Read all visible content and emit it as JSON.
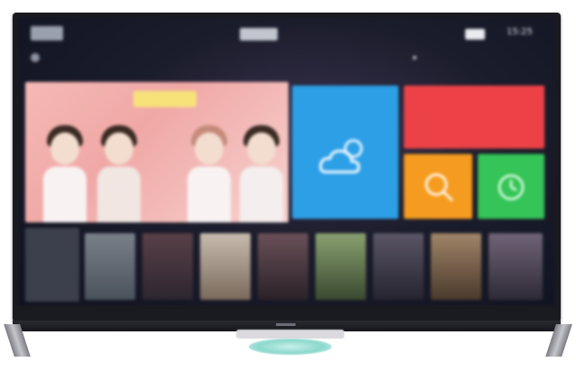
{
  "topbar": {
    "tabs": [
      {
        "label": "",
        "active": true
      },
      {
        "label": "",
        "active": false
      },
      {
        "label": "",
        "active": false
      },
      {
        "label": "",
        "active": false
      },
      {
        "label": "",
        "active": true
      },
      {
        "label": "",
        "active": false
      }
    ],
    "status_badge": "",
    "clock": "15:25"
  },
  "ticker": {
    "text": ""
  },
  "hero": {
    "banner": ""
  },
  "weather_tile": {
    "title": "",
    "subtitle": "",
    "detail": "",
    "icon": "cloud-sun-icon",
    "color": "#2d9fe6"
  },
  "red_tile": {
    "lines": [
      "",
      "",
      "",
      ""
    ],
    "color": "#ec4247"
  },
  "orange_tile": {
    "icon": "search-icon",
    "color": "#f59b1f"
  },
  "green_tile": {
    "icon": "history-icon",
    "color": "#34c457"
  },
  "bottom_panel": {
    "line1": "",
    "line2": ""
  },
  "posters": [
    {
      "color": "#5a6470"
    },
    {
      "color": "#3b3238"
    },
    {
      "color": "#9a8a7a"
    },
    {
      "color": "#4a3b40"
    },
    {
      "color": "#58684a"
    },
    {
      "color": "#3c3a46"
    },
    {
      "color": "#6a5848"
    },
    {
      "color": "#4a4550"
    }
  ]
}
